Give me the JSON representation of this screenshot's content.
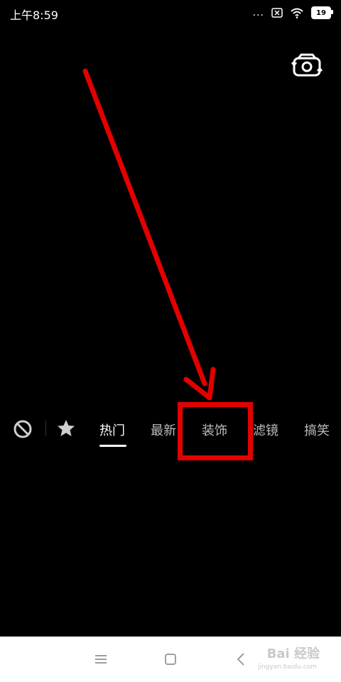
{
  "status_bar": {
    "time": "上午8:59",
    "dots": "...",
    "battery": "19"
  },
  "icons": {
    "no_effect": "no-effect-icon",
    "favorite": "star-icon",
    "camera_switch": "camera-switch-icon",
    "nav_menu": "menu-icon",
    "nav_home": "home-icon",
    "nav_back": "back-icon"
  },
  "tabs": [
    {
      "label": "热门",
      "active": true
    },
    {
      "label": "最新",
      "active": false
    },
    {
      "label": "装饰",
      "active": false
    },
    {
      "label": "滤镜",
      "active": false
    },
    {
      "label": "搞笑",
      "active": false
    }
  ],
  "watermark": {
    "text": "Bai 经验",
    "sub": "jingyan.baidu.com"
  },
  "colors": {
    "annotation": "#e30000",
    "background": "#000000",
    "nav_bar": "#ffffff"
  }
}
